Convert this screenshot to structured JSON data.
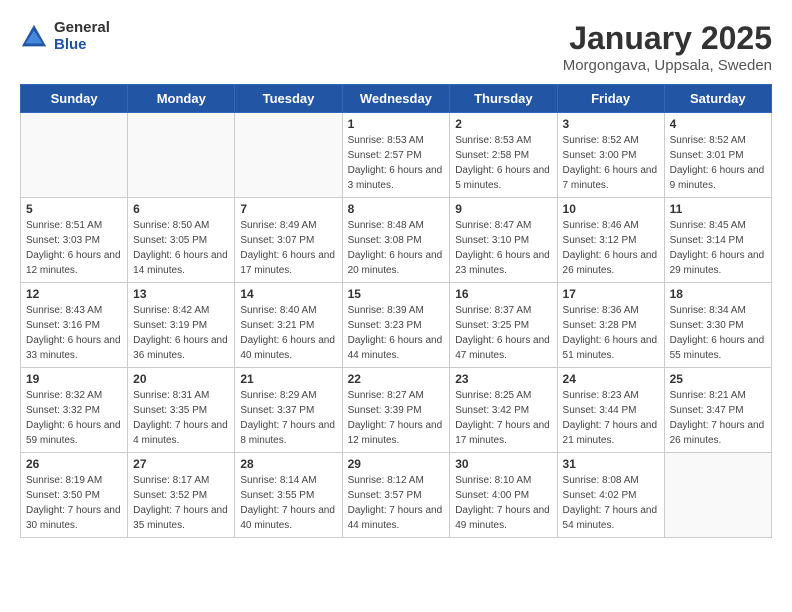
{
  "logo": {
    "general": "General",
    "blue": "Blue"
  },
  "header": {
    "month": "January 2025",
    "location": "Morgongava, Uppsala, Sweden"
  },
  "weekdays": [
    "Sunday",
    "Monday",
    "Tuesday",
    "Wednesday",
    "Thursday",
    "Friday",
    "Saturday"
  ],
  "weeks": [
    [
      {
        "day": "",
        "sunrise": "",
        "sunset": "",
        "daylight": ""
      },
      {
        "day": "",
        "sunrise": "",
        "sunset": "",
        "daylight": ""
      },
      {
        "day": "",
        "sunrise": "",
        "sunset": "",
        "daylight": ""
      },
      {
        "day": "1",
        "sunrise": "Sunrise: 8:53 AM",
        "sunset": "Sunset: 2:57 PM",
        "daylight": "Daylight: 6 hours and 3 minutes."
      },
      {
        "day": "2",
        "sunrise": "Sunrise: 8:53 AM",
        "sunset": "Sunset: 2:58 PM",
        "daylight": "Daylight: 6 hours and 5 minutes."
      },
      {
        "day": "3",
        "sunrise": "Sunrise: 8:52 AM",
        "sunset": "Sunset: 3:00 PM",
        "daylight": "Daylight: 6 hours and 7 minutes."
      },
      {
        "day": "4",
        "sunrise": "Sunrise: 8:52 AM",
        "sunset": "Sunset: 3:01 PM",
        "daylight": "Daylight: 6 hours and 9 minutes."
      }
    ],
    [
      {
        "day": "5",
        "sunrise": "Sunrise: 8:51 AM",
        "sunset": "Sunset: 3:03 PM",
        "daylight": "Daylight: 6 hours and 12 minutes."
      },
      {
        "day": "6",
        "sunrise": "Sunrise: 8:50 AM",
        "sunset": "Sunset: 3:05 PM",
        "daylight": "Daylight: 6 hours and 14 minutes."
      },
      {
        "day": "7",
        "sunrise": "Sunrise: 8:49 AM",
        "sunset": "Sunset: 3:07 PM",
        "daylight": "Daylight: 6 hours and 17 minutes."
      },
      {
        "day": "8",
        "sunrise": "Sunrise: 8:48 AM",
        "sunset": "Sunset: 3:08 PM",
        "daylight": "Daylight: 6 hours and 20 minutes."
      },
      {
        "day": "9",
        "sunrise": "Sunrise: 8:47 AM",
        "sunset": "Sunset: 3:10 PM",
        "daylight": "Daylight: 6 hours and 23 minutes."
      },
      {
        "day": "10",
        "sunrise": "Sunrise: 8:46 AM",
        "sunset": "Sunset: 3:12 PM",
        "daylight": "Daylight: 6 hours and 26 minutes."
      },
      {
        "day": "11",
        "sunrise": "Sunrise: 8:45 AM",
        "sunset": "Sunset: 3:14 PM",
        "daylight": "Daylight: 6 hours and 29 minutes."
      }
    ],
    [
      {
        "day": "12",
        "sunrise": "Sunrise: 8:43 AM",
        "sunset": "Sunset: 3:16 PM",
        "daylight": "Daylight: 6 hours and 33 minutes."
      },
      {
        "day": "13",
        "sunrise": "Sunrise: 8:42 AM",
        "sunset": "Sunset: 3:19 PM",
        "daylight": "Daylight: 6 hours and 36 minutes."
      },
      {
        "day": "14",
        "sunrise": "Sunrise: 8:40 AM",
        "sunset": "Sunset: 3:21 PM",
        "daylight": "Daylight: 6 hours and 40 minutes."
      },
      {
        "day": "15",
        "sunrise": "Sunrise: 8:39 AM",
        "sunset": "Sunset: 3:23 PM",
        "daylight": "Daylight: 6 hours and 44 minutes."
      },
      {
        "day": "16",
        "sunrise": "Sunrise: 8:37 AM",
        "sunset": "Sunset: 3:25 PM",
        "daylight": "Daylight: 6 hours and 47 minutes."
      },
      {
        "day": "17",
        "sunrise": "Sunrise: 8:36 AM",
        "sunset": "Sunset: 3:28 PM",
        "daylight": "Daylight: 6 hours and 51 minutes."
      },
      {
        "day": "18",
        "sunrise": "Sunrise: 8:34 AM",
        "sunset": "Sunset: 3:30 PM",
        "daylight": "Daylight: 6 hours and 55 minutes."
      }
    ],
    [
      {
        "day": "19",
        "sunrise": "Sunrise: 8:32 AM",
        "sunset": "Sunset: 3:32 PM",
        "daylight": "Daylight: 6 hours and 59 minutes."
      },
      {
        "day": "20",
        "sunrise": "Sunrise: 8:31 AM",
        "sunset": "Sunset: 3:35 PM",
        "daylight": "Daylight: 7 hours and 4 minutes."
      },
      {
        "day": "21",
        "sunrise": "Sunrise: 8:29 AM",
        "sunset": "Sunset: 3:37 PM",
        "daylight": "Daylight: 7 hours and 8 minutes."
      },
      {
        "day": "22",
        "sunrise": "Sunrise: 8:27 AM",
        "sunset": "Sunset: 3:39 PM",
        "daylight": "Daylight: 7 hours and 12 minutes."
      },
      {
        "day": "23",
        "sunrise": "Sunrise: 8:25 AM",
        "sunset": "Sunset: 3:42 PM",
        "daylight": "Daylight: 7 hours and 17 minutes."
      },
      {
        "day": "24",
        "sunrise": "Sunrise: 8:23 AM",
        "sunset": "Sunset: 3:44 PM",
        "daylight": "Daylight: 7 hours and 21 minutes."
      },
      {
        "day": "25",
        "sunrise": "Sunrise: 8:21 AM",
        "sunset": "Sunset: 3:47 PM",
        "daylight": "Daylight: 7 hours and 26 minutes."
      }
    ],
    [
      {
        "day": "26",
        "sunrise": "Sunrise: 8:19 AM",
        "sunset": "Sunset: 3:50 PM",
        "daylight": "Daylight: 7 hours and 30 minutes."
      },
      {
        "day": "27",
        "sunrise": "Sunrise: 8:17 AM",
        "sunset": "Sunset: 3:52 PM",
        "daylight": "Daylight: 7 hours and 35 minutes."
      },
      {
        "day": "28",
        "sunrise": "Sunrise: 8:14 AM",
        "sunset": "Sunset: 3:55 PM",
        "daylight": "Daylight: 7 hours and 40 minutes."
      },
      {
        "day": "29",
        "sunrise": "Sunrise: 8:12 AM",
        "sunset": "Sunset: 3:57 PM",
        "daylight": "Daylight: 7 hours and 44 minutes."
      },
      {
        "day": "30",
        "sunrise": "Sunrise: 8:10 AM",
        "sunset": "Sunset: 4:00 PM",
        "daylight": "Daylight: 7 hours and 49 minutes."
      },
      {
        "day": "31",
        "sunrise": "Sunrise: 8:08 AM",
        "sunset": "Sunset: 4:02 PM",
        "daylight": "Daylight: 7 hours and 54 minutes."
      },
      {
        "day": "",
        "sunrise": "",
        "sunset": "",
        "daylight": ""
      }
    ]
  ]
}
